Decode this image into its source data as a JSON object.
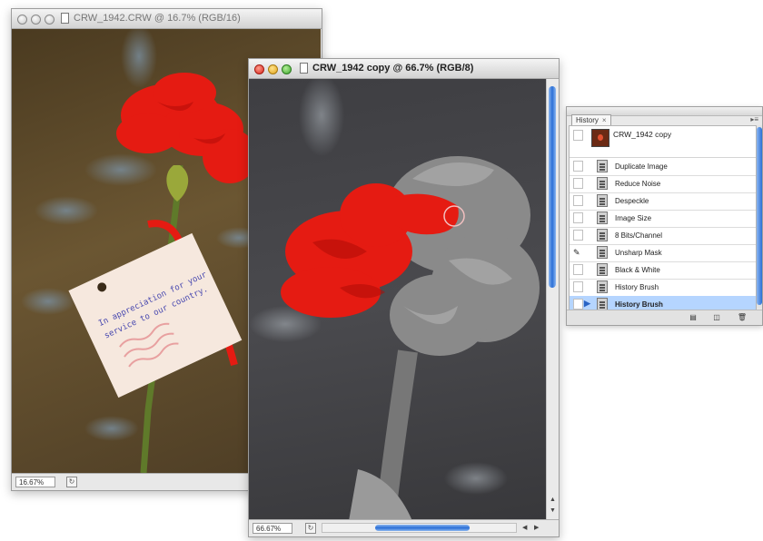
{
  "window_back": {
    "title": "CRW_1942.CRW @ 16.7% (RGB/16)",
    "zoom": "16.67%"
  },
  "window_front": {
    "title": "CRW_1942 copy @ 66.7% (RGB/8)",
    "zoom": "66.67%"
  },
  "tag_text": {
    "line1": "In appreciation for your",
    "line2": "service to our country."
  },
  "history_panel": {
    "tab_label": "History",
    "tab_close": "×",
    "snapshot_label": "CRW_1942 copy",
    "items": [
      {
        "label": "Duplicate Image"
      },
      {
        "label": "Reduce Noise"
      },
      {
        "label": "Despeckle"
      },
      {
        "label": "Image Size"
      },
      {
        "label": "8 Bits/Channel"
      },
      {
        "label": "Unsharp Mask"
      },
      {
        "label": "Black & White"
      },
      {
        "label": "History Brush"
      },
      {
        "label": "History Brush"
      }
    ],
    "selected_index": 8,
    "source_index": 5
  },
  "colors": {
    "accent_selection": "#b5d5ff",
    "scroll_thumb": "#2b6fd6",
    "flower_red": "#e51b12"
  }
}
